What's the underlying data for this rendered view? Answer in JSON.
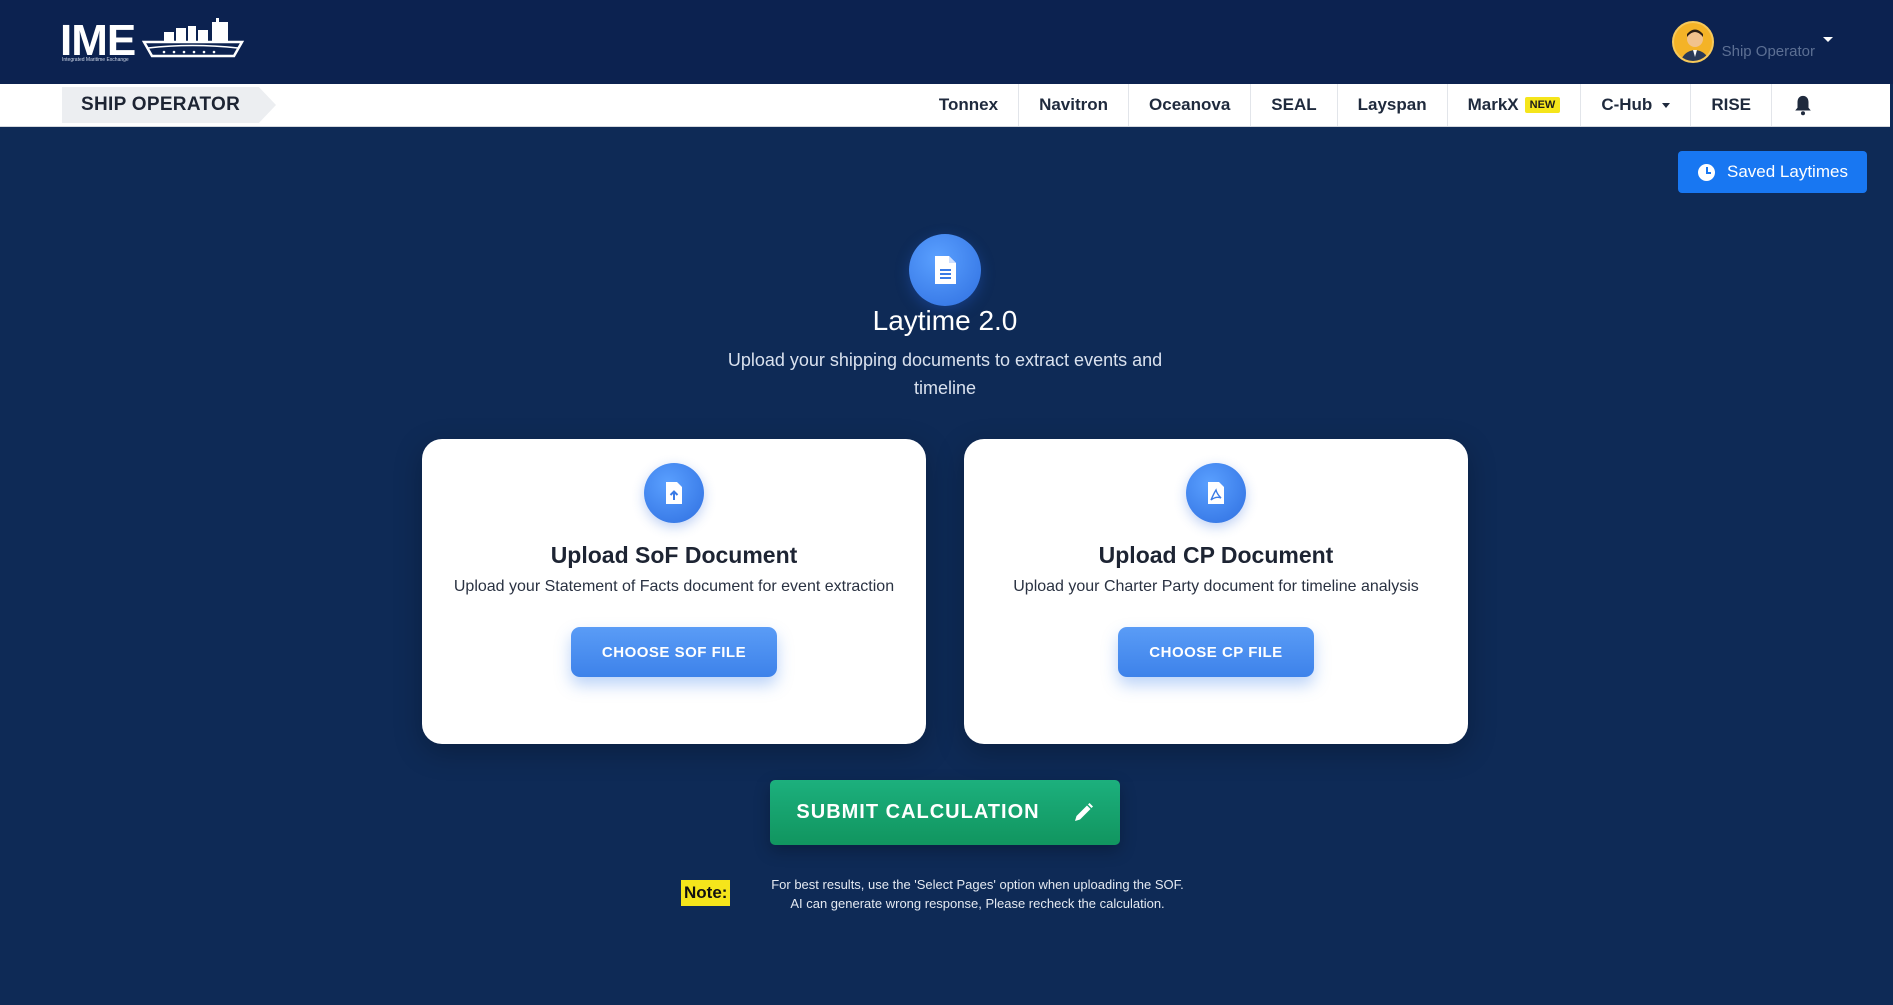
{
  "header": {
    "logo_text": "IME",
    "logo_subtitle": "Integrated Maritime Exchange",
    "user_name": "Ship Operator"
  },
  "nav": {
    "breadcrumb": "SHIP OPERATOR",
    "items": [
      {
        "label": "Tonnex"
      },
      {
        "label": "Navitron"
      },
      {
        "label": "Oceanova"
      },
      {
        "label": "SEAL"
      },
      {
        "label": "Layspan"
      },
      {
        "label": "MarkX",
        "badge": "NEW"
      },
      {
        "label": "C-Hub"
      },
      {
        "label": "RISE"
      }
    ]
  },
  "saved_laytimes_label": "Saved Laytimes",
  "hero": {
    "title": "Laytime 2.0",
    "subtitle": "Upload your shipping documents to extract events and timeline"
  },
  "cards": {
    "sof": {
      "title": "Upload SoF Document",
      "description": "Upload your Statement of Facts document for event extraction",
      "button": "CHOOSE SOF FILE"
    },
    "cp": {
      "title": "Upload CP Document",
      "description": "Upload your Charter Party document for timeline analysis",
      "button": "CHOOSE CP FILE"
    }
  },
  "submit_label": "SUBMIT CALCULATION",
  "note": {
    "label": "Note:",
    "line1": "For best results, use the 'Select Pages' option when uploading the SOF.",
    "line2": "AI can generate wrong response, Please recheck the calculation."
  },
  "colors": {
    "background": "#0e2a56",
    "header": "#0c2250",
    "primary_blue": "#1877f2",
    "submit_green": "#11955f",
    "note_highlight": "#f5e51b"
  }
}
